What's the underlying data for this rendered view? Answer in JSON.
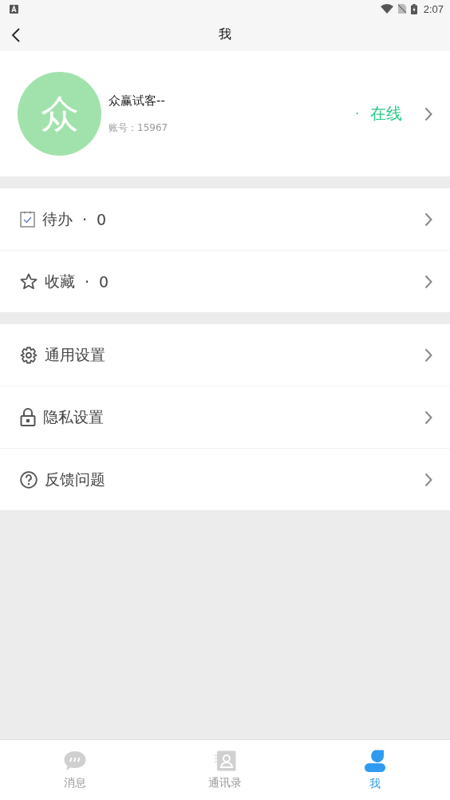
{
  "status_bar": {
    "time": "2:07"
  },
  "header": {
    "title": "我"
  },
  "profile": {
    "avatar_text": "众",
    "name": "众赢试客--",
    "account": "账号：15967",
    "status_dot": "·",
    "status": "在线"
  },
  "menu_groups": [
    {
      "items": [
        {
          "kind": "todo",
          "label": "待办",
          "dot": "·",
          "count": "0"
        },
        {
          "kind": "star",
          "label": "收藏",
          "dot": "·",
          "count": "0"
        }
      ]
    },
    {
      "items": [
        {
          "kind": "gear",
          "label": "通用设置"
        },
        {
          "kind": "lock",
          "label": "隐私设置"
        },
        {
          "kind": "help",
          "label": "反馈问题"
        }
      ]
    }
  ],
  "tabs": [
    {
      "kind": "chat",
      "label": "消息",
      "selected": false
    },
    {
      "kind": "contacts",
      "label": "通讯录",
      "selected": false
    },
    {
      "kind": "person",
      "label": "我",
      "selected": true
    }
  ]
}
